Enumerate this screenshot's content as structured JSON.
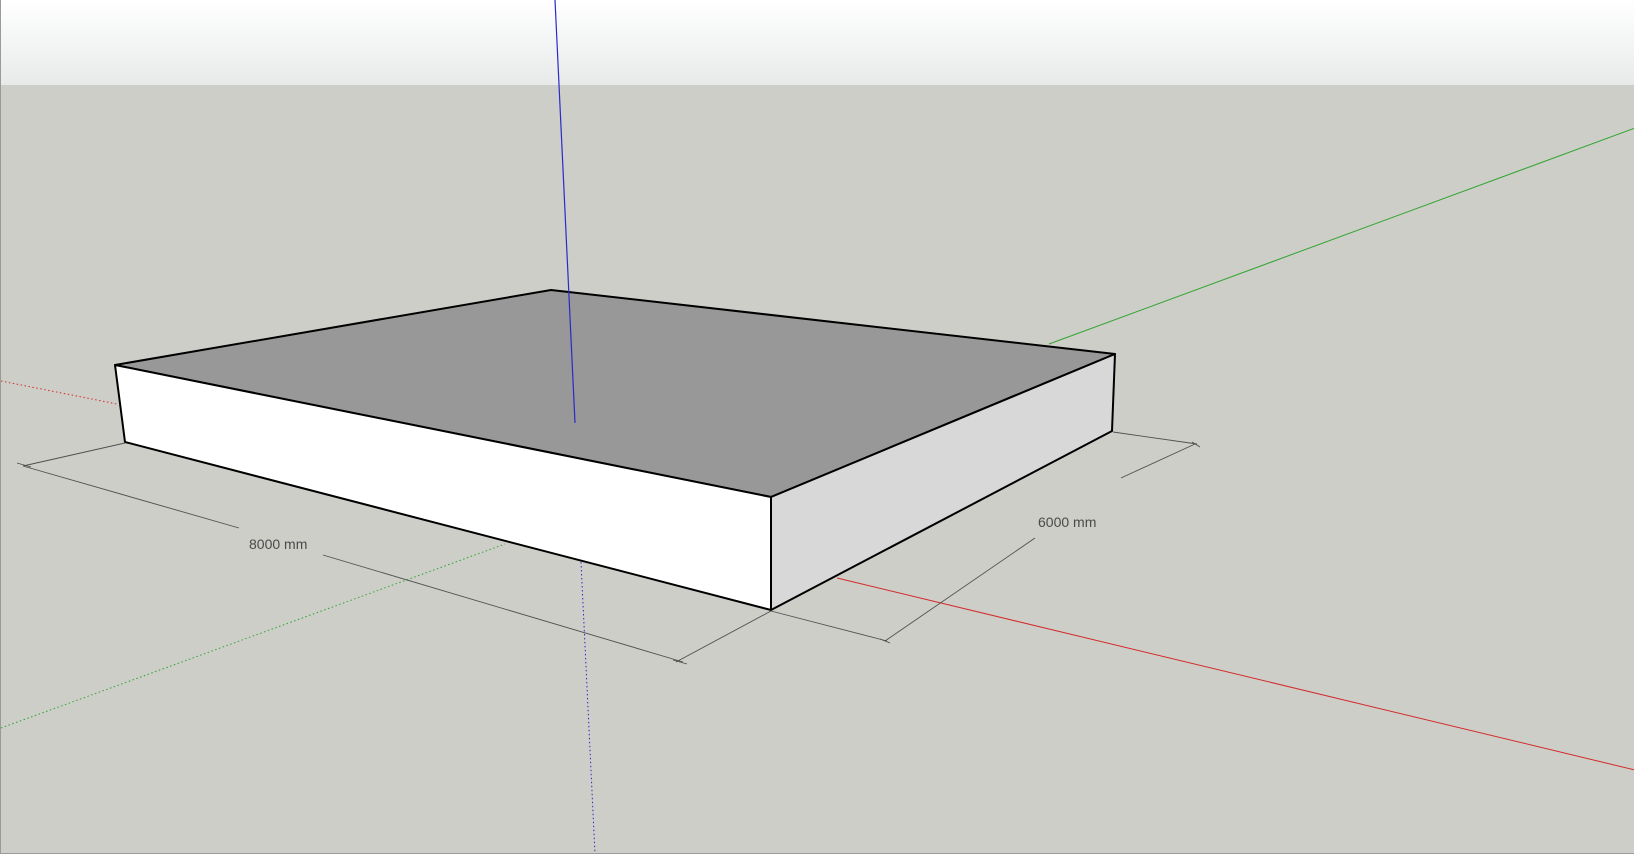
{
  "viewport": {
    "sky_color_top": "#ffffff",
    "sky_color_bottom": "#e8eaea",
    "ground_color": "#cdcec8"
  },
  "axes": {
    "red_axis_color": "#d42a2a",
    "green_axis_color": "#2fa42f",
    "blue_axis_color": "#2a2ac8"
  },
  "model": {
    "top_face_color": "#989898",
    "front_face_color": "#ffffff",
    "side_face_color": "#d8d8d8",
    "edge_color": "#000000"
  },
  "dimensions": {
    "length_label": "8000 mm",
    "width_label": "6000 mm"
  }
}
